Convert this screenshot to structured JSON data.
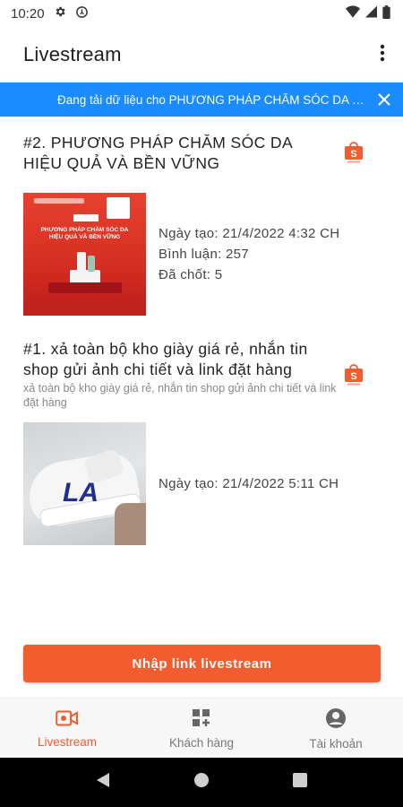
{
  "status_bar": {
    "time": "10:20"
  },
  "app_bar": {
    "title": "Livestream",
    "menu_icon": "more-vert-icon"
  },
  "banner": {
    "text": "Đang tải dữ liệu cho PHƯƠNG PHÁP CHĂM SÓC DA HIỆU QUẢ VÀ BỀN VỮNG",
    "close_icon": "close-icon"
  },
  "livestreams": [
    {
      "title": "#2. PHƯƠNG PHÁP CHĂM SÓC DA HIỆU QUẢ VÀ BỀN VỮNG",
      "subtitle": "",
      "created": "Ngày tạo: 21/4/2022 4:32 CH",
      "comments": "Bình luận: 257",
      "closed": "Đã chốt: 5",
      "thumb_label": "PHƯƠNG PHÁP CHĂM SÓC DA HIỆU QUẢ VÀ BỀN VỮNG",
      "platform_icon": "shopee-icon"
    },
    {
      "title": "#1. xả toàn bộ kho giày giá rẻ, nhắn tin shop gửi ảnh chi tiết và link đặt hàng",
      "subtitle": "xả toàn bộ kho giày giá rẻ, nhắn tin shop gửi ảnh chi tiết và link đặt hàng",
      "created": "Ngày tạo: 21/4/2022 5:11 CH",
      "thumb_label": "LA",
      "platform_icon": "shopee-icon"
    }
  ],
  "cta": {
    "label": "Nhập link livestream"
  },
  "bottom_nav": [
    {
      "label": "Livestream",
      "icon": "video-camera-icon",
      "active": true
    },
    {
      "label": "Khách hàng",
      "icon": "grid-add-icon",
      "active": false
    },
    {
      "label": "Tài khoản",
      "icon": "account-circle-icon",
      "active": false
    }
  ],
  "colors": {
    "accent": "#f25c2e",
    "banner": "#1a8cff",
    "nav_bg": "#f7f7f7"
  }
}
